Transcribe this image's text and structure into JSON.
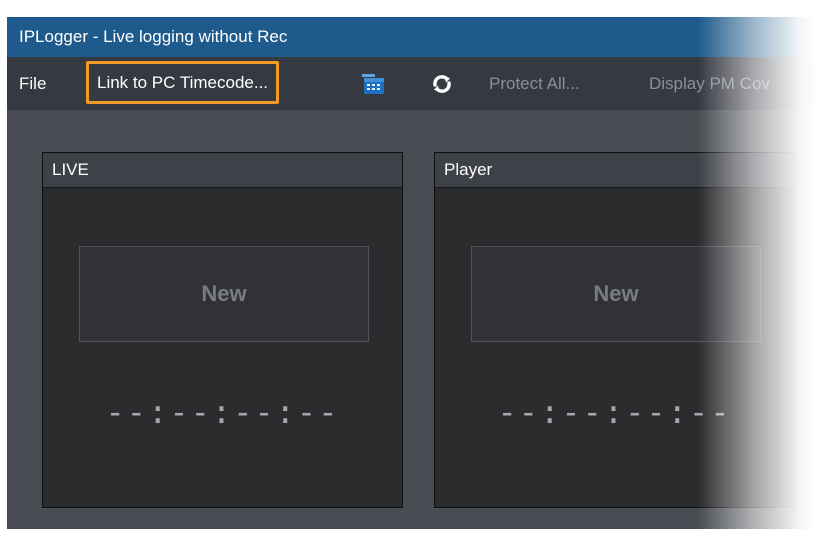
{
  "window": {
    "title": "IPLogger - Live logging without Rec"
  },
  "menu": {
    "file": "File",
    "link_to_pc_timecode": "Link to PC Timecode...",
    "protect_all": "Protect All...",
    "display_pm": "Display PM Cov"
  },
  "icons": {
    "calendar": "calendar-icon",
    "sync": "sync-icon"
  },
  "colors": {
    "title_bar": "#1e5b8c",
    "menu_bar": "#353941",
    "highlight": "#f39a24",
    "workspace": "#494d53"
  },
  "panels": [
    {
      "title": "LIVE",
      "new_label": "New",
      "timecode": "--:--:--:--"
    },
    {
      "title": "Player",
      "new_label": "New",
      "timecode": "--:--:--:--"
    }
  ]
}
